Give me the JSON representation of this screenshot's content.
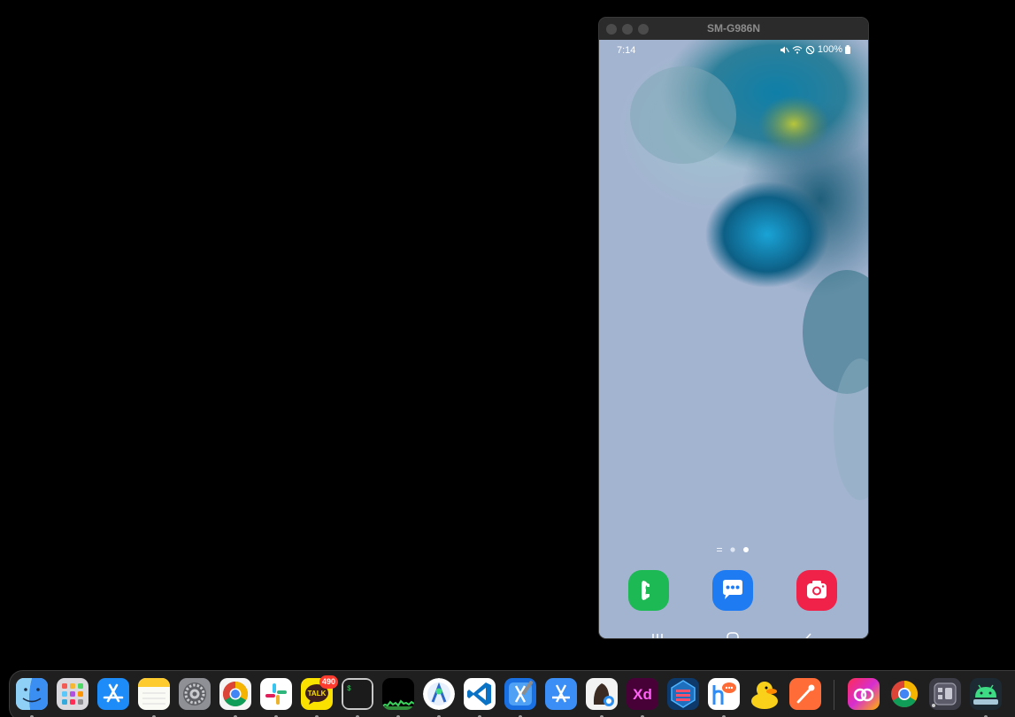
{
  "emulator": {
    "title": "SM-G986N"
  },
  "phone": {
    "status_bar": {
      "time": "7:14",
      "battery": "100%"
    },
    "home_pages": {
      "count": 3,
      "current": 3
    },
    "dock_apps": [
      {
        "name": "Phone",
        "icon": "phone-icon",
        "color": "#1db954"
      },
      {
        "name": "Messages",
        "icon": "messages-icon",
        "color": "#1e7bf2"
      },
      {
        "name": "Camera",
        "icon": "camera-icon",
        "color": "#f0224a"
      }
    ]
  },
  "mac_dock": {
    "kakaotalk_badge": "490",
    "kakaotalk_label": "TALK",
    "adobe_xd_label": "Xd",
    "terminal_prompt": "$",
    "apps": [
      "finder-icon",
      "launchpad-icon",
      "app-store-icon",
      "notes-icon",
      "system-preferences-icon",
      "chrome-icon",
      "slack-icon",
      "kakaotalk-icon",
      "terminal-icon",
      "activity-monitor-icon",
      "android-studio-icon",
      "vscode-icon",
      "xcode-icon",
      "simulator-icon",
      "sequel-ace-icon",
      "adobe-xd-icon",
      "sourcetree-icon",
      "hiworks-icon",
      "cyberduck-icon",
      "postman-icon",
      "creative-cloud-icon",
      "chrome-icon",
      "keychain-icon",
      "android-emulator-icon"
    ]
  }
}
